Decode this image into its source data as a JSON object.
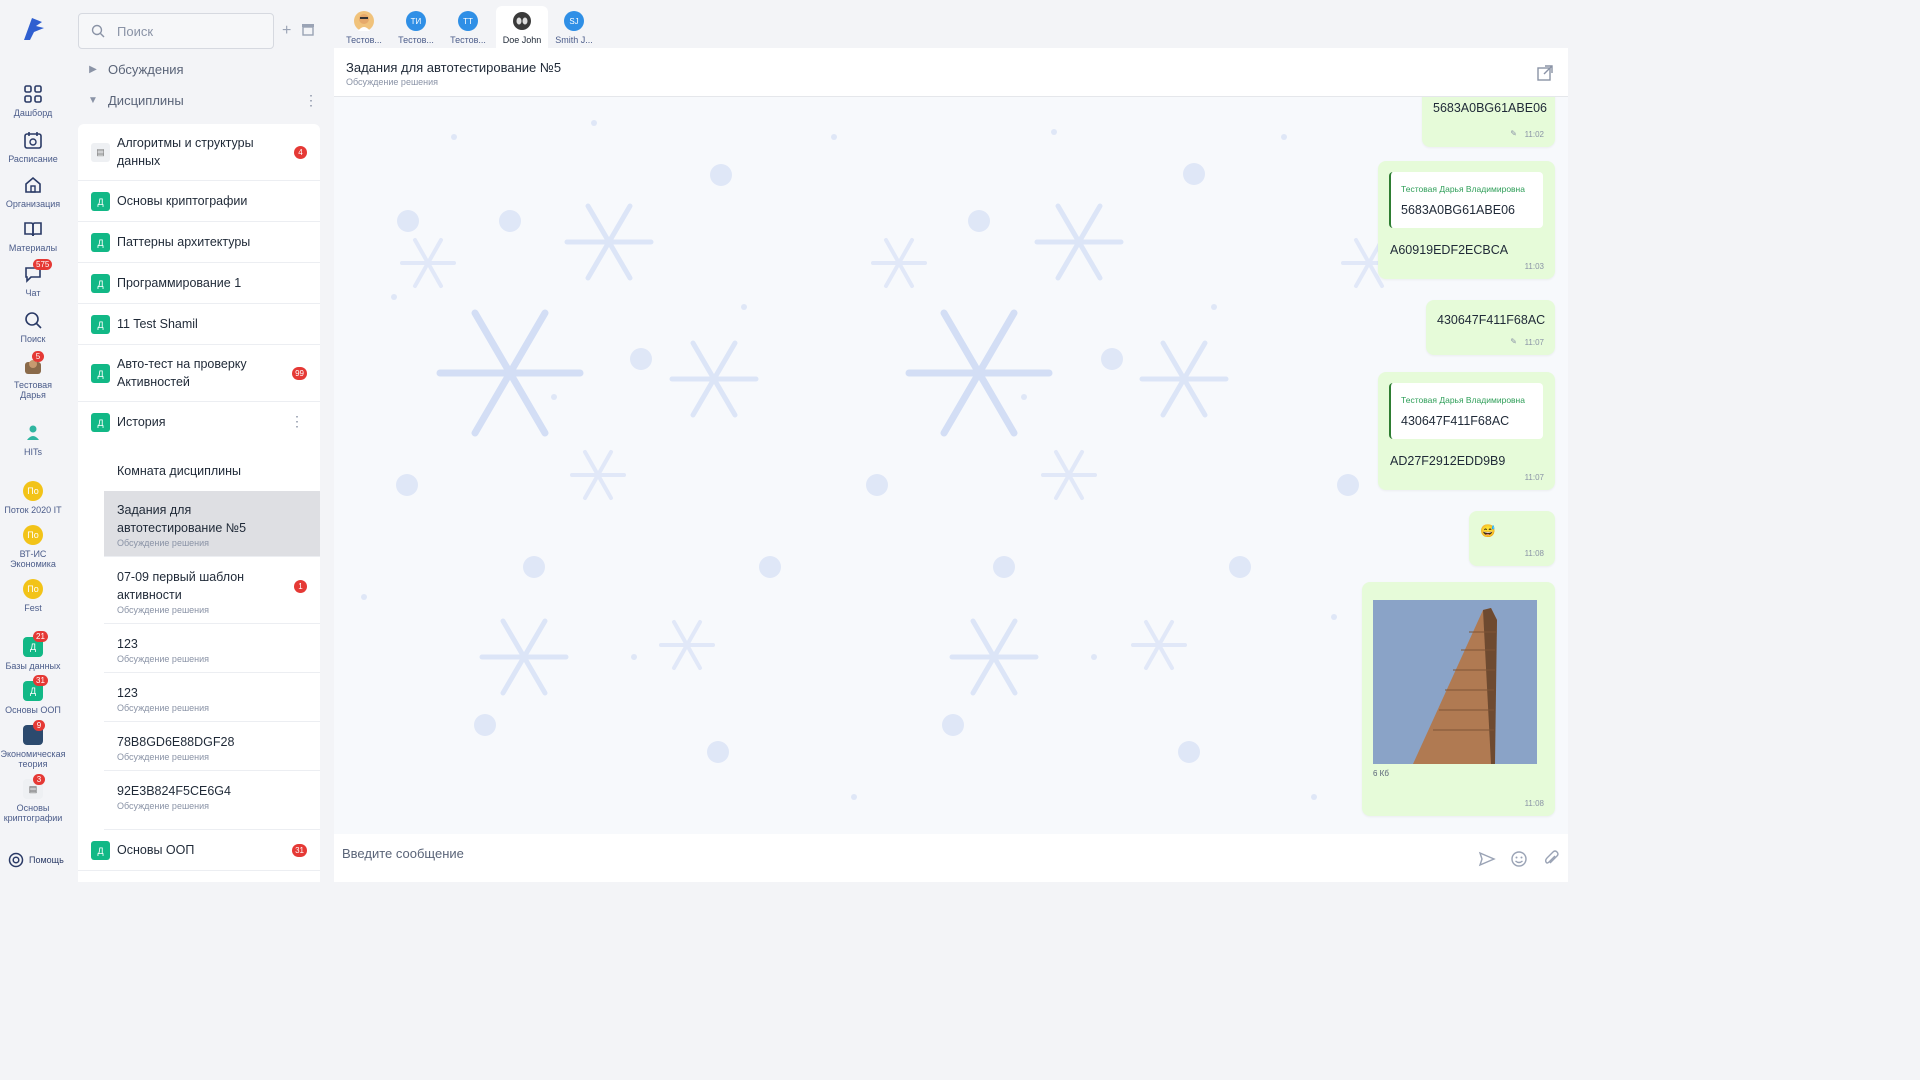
{
  "rail": {
    "items": [
      {
        "label": "Дашборд",
        "icon": "dashboard-icon"
      },
      {
        "label": "Расписание",
        "icon": "calendar-icon"
      },
      {
        "label": "Организация",
        "icon": "home-icon"
      },
      {
        "label": "Материалы",
        "icon": "book-icon"
      },
      {
        "label": "Чат",
        "icon": "chat-icon",
        "badge": "575"
      },
      {
        "label": "Поиск",
        "icon": "search-icon"
      },
      {
        "label": "Тестовая Дарья",
        "icon": "avatar-icon",
        "badge": "5"
      },
      {
        "label": "HITs",
        "icon": "hits-icon"
      },
      {
        "label": "Поток 2020 IT",
        "short": "По"
      },
      {
        "label": "ВТ-ИС Экономика",
        "short": "По"
      },
      {
        "label": "Fest",
        "short": "По"
      },
      {
        "label": "Базы данных",
        "short": "Д",
        "badge": "21"
      },
      {
        "label": "Основы ООП",
        "short": "Д",
        "badge": "31"
      },
      {
        "label": "Экономическая теория",
        "badge": "9"
      },
      {
        "label": "Основы криптографии",
        "badge": "3"
      }
    ],
    "help": "Помощь"
  },
  "panel": {
    "search_placeholder": "Поиск",
    "sections": {
      "discussions": "Обсуждения",
      "disciplines": "Дисциплины"
    },
    "disciplines": [
      {
        "title": "Алгоритмы и структуры данных",
        "badge": "4",
        "icon": "Д"
      },
      {
        "title": "Основы криптографии",
        "icon": "Д"
      },
      {
        "title": "Паттерны архитектуры",
        "icon": "Д"
      },
      {
        "title": "Программирование 1",
        "icon": "Д"
      },
      {
        "title": "11 Test Shamil",
        "icon": "Д"
      },
      {
        "title": "Авто-тест на проверку Активностей",
        "badge": "99",
        "icon": "Д"
      },
      {
        "title": "История",
        "icon": "Д"
      }
    ],
    "history_rooms": [
      {
        "title": "Комната дисциплины"
      },
      {
        "title": "Задания для автотестирование №5",
        "subtitle": "Обсуждение решения",
        "active": true
      },
      {
        "title": "07-09 первый шаблон активности",
        "subtitle": "Обсуждение решения",
        "badge": "1"
      },
      {
        "title": "123",
        "subtitle": "Обсуждение решения"
      },
      {
        "title": "123",
        "subtitle": "Обсуждение решения"
      },
      {
        "title": "78B8GD6E88DGF28",
        "subtitle": "Обсуждение решения"
      },
      {
        "title": "92E3B824F5CE6G4",
        "subtitle": "Обсуждение решения"
      }
    ],
    "last_discipline": {
      "title": "Основы ООП",
      "badge": "31",
      "icon": "Д"
    }
  },
  "tabs": [
    {
      "label": "Тестов...",
      "initials": "",
      "color": "#f0c27b"
    },
    {
      "label": "Тестов...",
      "initials": "ТИ",
      "color": "#2f8fe6"
    },
    {
      "label": "Тестов...",
      "initials": "ТТ",
      "color": "#2f8fe6"
    },
    {
      "label": "Doe John",
      "initials": "",
      "color": "#444444",
      "active": true
    },
    {
      "label": "Smith J...",
      "initials": "SJ",
      "color": "#2f8fe6"
    }
  ],
  "chat": {
    "title": "Задания для автотестирование №5",
    "subtitle": "Обсуждение решения",
    "messages": [
      {
        "text": "5683A0BG61ABE06",
        "time": "11:02",
        "edited": true
      },
      {
        "quote_author": "Тестовая Дарья Владимировна",
        "quote_text": "5683A0BG61ABE06",
        "text": "A60919EDF2ECBCA",
        "time": "11:03"
      },
      {
        "text": "430647F411F68AC",
        "time": "11:07",
        "edited": true
      },
      {
        "quote_author": "Тестовая Дарья Владимировна",
        "quote_text": "430647F411F68AC",
        "text": "AD27F2912EDD9B9",
        "time": "11:07"
      },
      {
        "text": "😅",
        "time": "11:08"
      },
      {
        "file_size": "6 Кб",
        "time": "11:08"
      }
    ],
    "composer_placeholder": "Введите сообщение"
  },
  "colors": {
    "accent_green": "#12b886",
    "badge_red": "#e53935",
    "bubble": "#e6fbd9"
  }
}
